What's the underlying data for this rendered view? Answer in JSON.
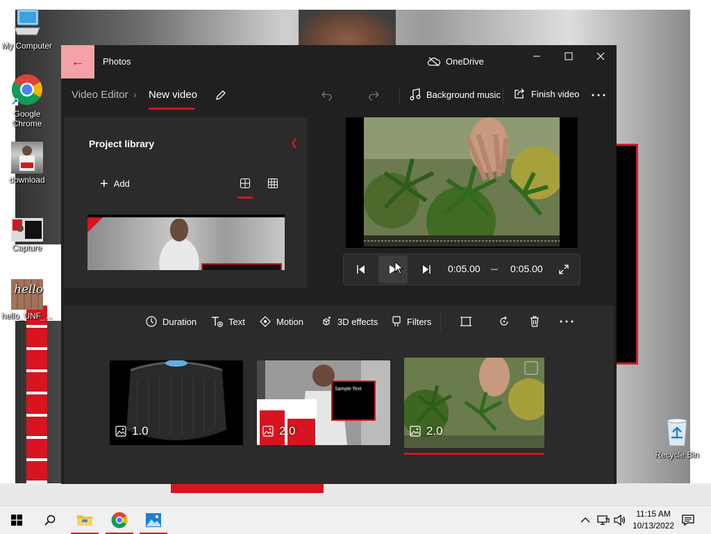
{
  "desktop": {
    "icons": [
      {
        "label": "My Computer"
      },
      {
        "label": "Google Chrome"
      },
      {
        "label": "download"
      },
      {
        "label": "Capture"
      },
      {
        "label": "hello_UNF_..."
      }
    ],
    "recycle_bin": "Recycle Bin"
  },
  "window": {
    "app_title": "Photos",
    "onedrive": "OneDrive",
    "breadcrumb": {
      "root": "Video Editor",
      "current": "New video"
    },
    "commands": {
      "background_music": "Background music",
      "finish_video": "Finish video"
    },
    "library": {
      "title": "Project library",
      "add": "Add"
    },
    "player": {
      "current_time": "0:05.00",
      "total_time": "0:05.00"
    },
    "tools": {
      "duration": "Duration",
      "text": "Text",
      "motion": "Motion",
      "effects": "3D effects",
      "filters": "Filters"
    },
    "clips": [
      {
        "duration": "1.0",
        "selected": false
      },
      {
        "duration": "2.0",
        "selected": false,
        "overlay_text": "Sample Text"
      },
      {
        "duration": "2.0",
        "selected": true
      }
    ],
    "accent": "#d7141f"
  },
  "taskbar": {
    "apps": [
      {
        "name": "file-explorer",
        "active": true
      },
      {
        "name": "chrome",
        "active": true
      },
      {
        "name": "photos",
        "active": true
      }
    ],
    "time": "11:15 AM",
    "date": "10/13/2022"
  }
}
